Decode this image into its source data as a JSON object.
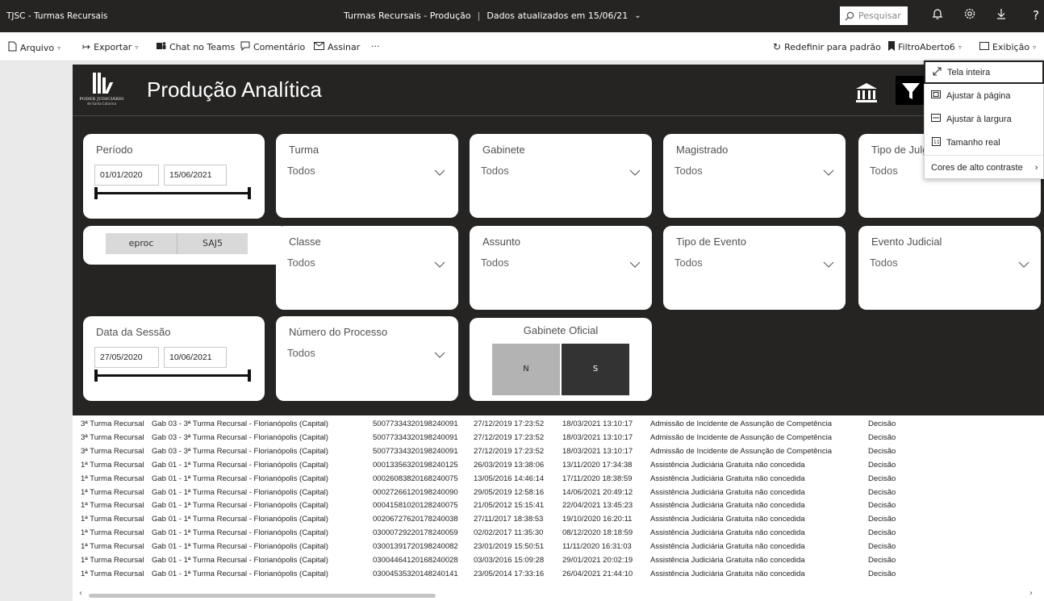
{
  "titlebar": {
    "app_name": "TJSC - Turmas Recursais",
    "report_name": "Turmas Recursais - Produção",
    "data_updated": "Dados atualizados em 15/06/21",
    "search_placeholder": "Pesquisar"
  },
  "toolbar": {
    "arquivo": "Arquivo",
    "exportar": "Exportar",
    "chat_teams": "Chat no Teams",
    "comentario": "Comentário",
    "assinar": "Assinar",
    "more": "···",
    "redefinir": "Redefinir para padrão",
    "bookmark": "FiltroAberto6",
    "exibicao": "Exibição"
  },
  "report": {
    "title": "Produção Analítica",
    "logo_org": "PODER JUDICIÁRIO",
    "logo_sub": "de Santa Catarina"
  },
  "filters": {
    "periodo": {
      "label": "Período",
      "start": "01/01/2020",
      "end": "15/06/2021"
    },
    "turma": {
      "label": "Turma",
      "value": "Todos"
    },
    "gabinete": {
      "label": "Gabinete",
      "value": "Todos"
    },
    "magistrado": {
      "label": "Magistrado",
      "value": "Todos"
    },
    "tipo_julg": {
      "label": "Tipo de Julg",
      "value": "Todos"
    },
    "sistema": {
      "opt1": "eproc",
      "opt2": "SAJ5"
    },
    "classe": {
      "label": "Classe",
      "value": "Todos"
    },
    "assunto": {
      "label": "Assunto",
      "value": "Todos"
    },
    "tipo_evento": {
      "label": "Tipo de Evento",
      "value": "Todos"
    },
    "evento_judicial": {
      "label": "Evento Judicial",
      "value": "Todos"
    },
    "data_sessao": {
      "label": "Data da Sessão",
      "start": "27/05/2020",
      "end": "10/06/2021"
    },
    "numero_processo": {
      "label": "Número do Processo",
      "value": "Todos"
    },
    "gabinete_oficial": {
      "label": "Gabinete Oficial",
      "opt_n": "N",
      "opt_s": "S"
    }
  },
  "table": {
    "rows": [
      [
        "3ª Turma Recursal",
        "Gab 03 - 3ª Turma Recursal - Florianópolis (Capital)",
        "50077334320198240091",
        "27/12/2019 17:23:52",
        "18/03/2021 13:10:17",
        "Admissão de Incidente de Assunção de Competência",
        "Decisão"
      ],
      [
        "3ª Turma Recursal",
        "Gab 03 - 3ª Turma Recursal - Florianópolis (Capital)",
        "50077334320198240091",
        "27/12/2019 17:23:52",
        "18/03/2021 13:10:17",
        "Admissão de Incidente de Assunção de Competência",
        "Decisão"
      ],
      [
        "3ª Turma Recursal",
        "Gab 03 - 3ª Turma Recursal - Florianópolis (Capital)",
        "50077334320198240091",
        "27/12/2019 17:23:52",
        "18/03/2021 13:10:17",
        "Admissão de Incidente de Assunção de Competência",
        "Decisão"
      ],
      [
        "1ª Turma Recursal",
        "Gab 01 - 1ª Turma Recursal - Florianópolis (Capital)",
        "00013356320198240125",
        "26/03/2019 13:38:06",
        "13/11/2020 17:34:38",
        "Assistência Judiciária Gratuita não concedida",
        "Decisão"
      ],
      [
        "1ª Turma Recursal",
        "Gab 01 - 1ª Turma Recursal - Florianópolis (Capital)",
        "00026083820168240075",
        "13/05/2016 14:46:14",
        "17/11/2020 18:38:59",
        "Assistência Judiciária Gratuita não concedida",
        "Decisão"
      ],
      [
        "1ª Turma Recursal",
        "Gab 01 - 1ª Turma Recursal - Florianópolis (Capital)",
        "00027266120198240090",
        "29/05/2019 12:58:16",
        "14/06/2021 20:49:12",
        "Assistência Judiciária Gratuita não concedida",
        "Decisão"
      ],
      [
        "1ª Turma Recursal",
        "Gab 01 - 1ª Turma Recursal - Florianópolis (Capital)",
        "00041581020128240075",
        "21/05/2012 15:15:41",
        "22/04/2021 13:45:23",
        "Assistência Judiciária Gratuita não concedida",
        "Decisão"
      ],
      [
        "1ª Turma Recursal",
        "Gab 01 - 1ª Turma Recursal - Florianópolis (Capital)",
        "00206727620178240038",
        "27/11/2017 18:38:53",
        "19/10/2020 16:20:11",
        "Assistência Judiciária Gratuita não concedida",
        "Decisão"
      ],
      [
        "1ª Turma Recursal",
        "Gab 01 - 1ª Turma Recursal - Florianópolis (Capital)",
        "03000729220178240059",
        "02/02/2017 11:35:30",
        "08/12/2020 18:18:59",
        "Assistência Judiciária Gratuita não concedida",
        "Decisão"
      ],
      [
        "1ª Turma Recursal",
        "Gab 01 - 1ª Turma Recursal - Florianópolis (Capital)",
        "03001391720198240082",
        "23/01/2019 15:50:51",
        "11/11/2020 16:31:03",
        "Assistência Judiciária Gratuita não concedida",
        "Decisão"
      ],
      [
        "1ª Turma Recursal",
        "Gab 01 - 1ª Turma Recursal - Florianópolis (Capital)",
        "03004464120168240028",
        "03/03/2016 15:09:28",
        "29/01/2021 20:02:19",
        "Assistência Judiciária Gratuita não concedida",
        "Decisão"
      ],
      [
        "1ª Turma Recursal",
        "Gab 01 - 1ª Turma Recursal - Florianópolis (Capital)",
        "03004535320148240141",
        "23/05/2014 17:33:16",
        "26/04/2021 21:44:10",
        "Assistência Judiciária Gratuita não concedida",
        "Decisão"
      ]
    ]
  },
  "view_menu": {
    "items": [
      {
        "label": "Tela inteira",
        "icon": "fullscreen-icon"
      },
      {
        "label": "Ajustar à página",
        "icon": "fit-page-icon"
      },
      {
        "label": "Ajustar à largura",
        "icon": "fit-width-icon"
      },
      {
        "label": "Tamanho real",
        "icon": "actual-size-icon"
      },
      {
        "label": "Cores de alto contraste",
        "icon": "chevron-right-icon"
      }
    ]
  }
}
